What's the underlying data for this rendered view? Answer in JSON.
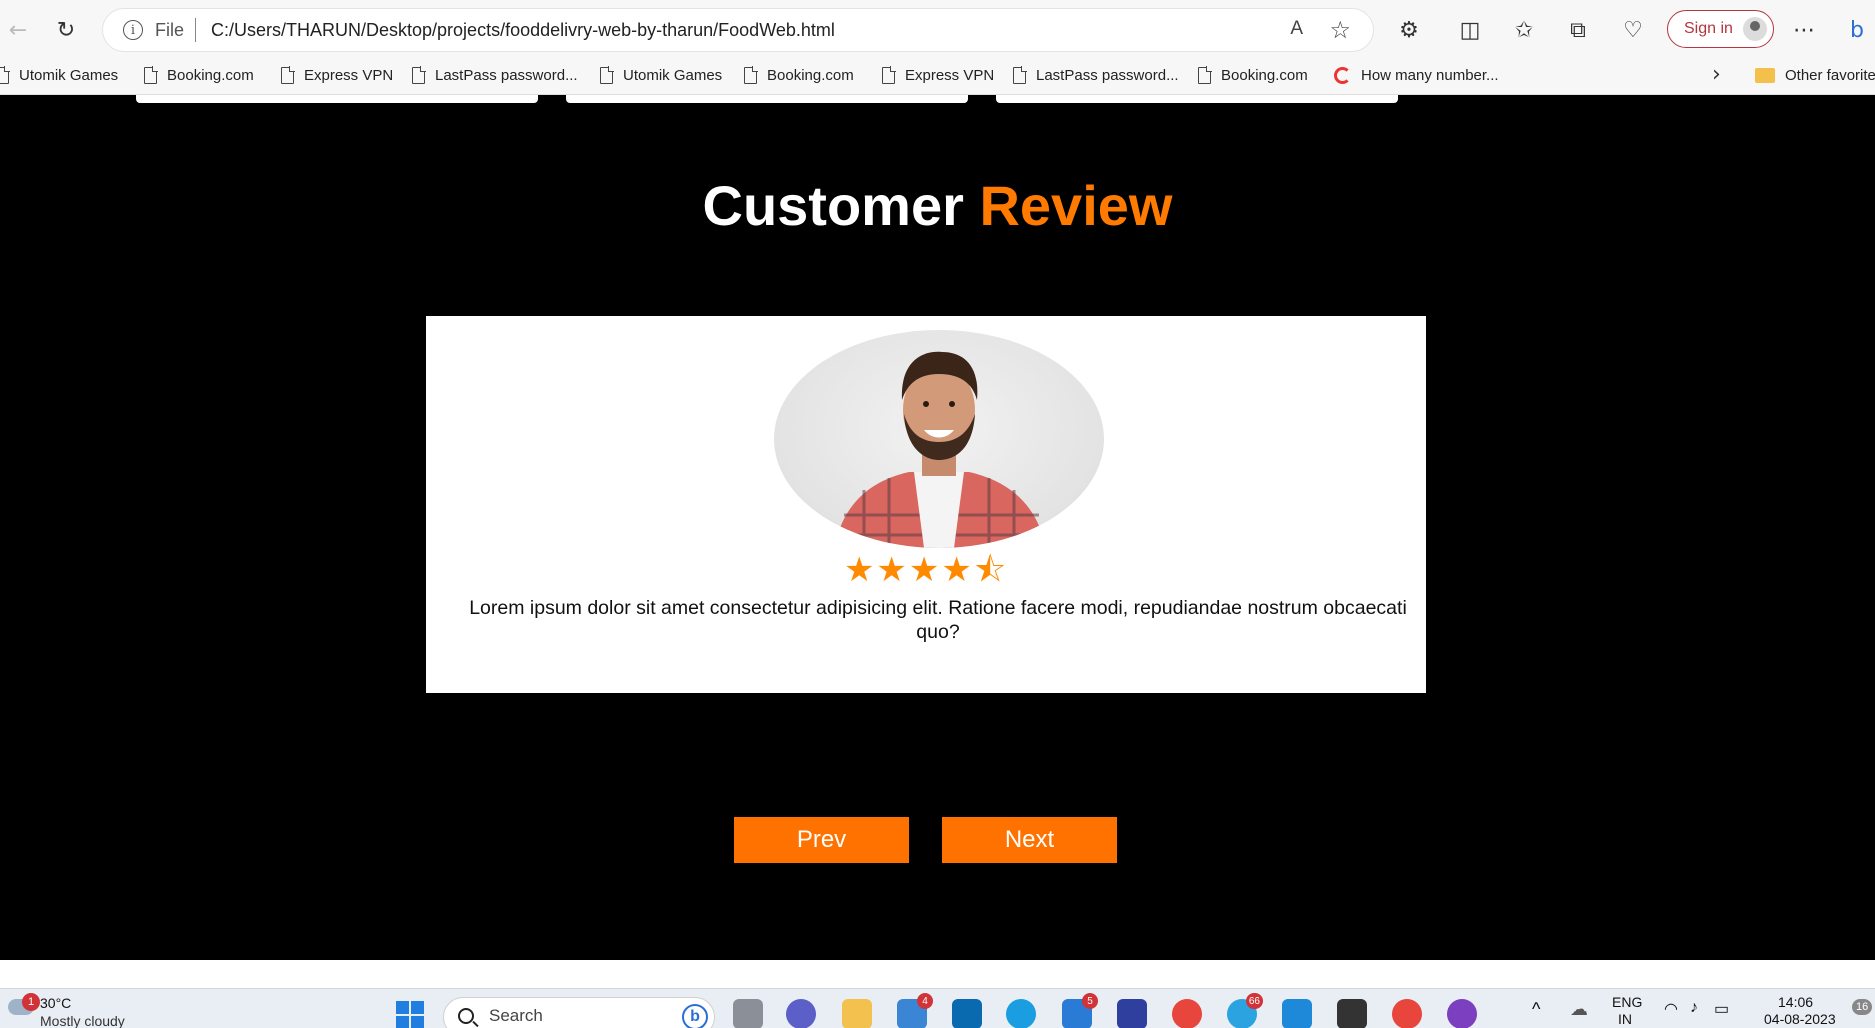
{
  "browser": {
    "address_prefix": "File",
    "url": "C:/Users/THARUN/Desktop/projects/fooddelivry-web-by-tharun/FoodWeb.html",
    "sign_in_label": "Sign in",
    "read_aloud_label": "A",
    "bookmarks": [
      {
        "label": "Utomik Games",
        "icon": "doc-icon"
      },
      {
        "label": "Booking.com",
        "icon": "doc-icon"
      },
      {
        "label": "Express VPN",
        "icon": "doc-icon"
      },
      {
        "label": "LastPass password...",
        "icon": "doc-icon"
      },
      {
        "label": "Utomik Games",
        "icon": "doc-icon"
      },
      {
        "label": "Booking.com",
        "icon": "doc-icon"
      },
      {
        "label": "Express VPN",
        "icon": "doc-icon"
      },
      {
        "label": "LastPass password...",
        "icon": "doc-icon"
      },
      {
        "label": "Booking.com",
        "icon": "doc-icon"
      },
      {
        "label": "How many number...",
        "icon": "google-icon"
      }
    ],
    "other_favorites_label": "Other favorite"
  },
  "page": {
    "title_part1": "Customer",
    "title_part2": "Review",
    "accent_color": "#ff7a00",
    "review": {
      "rating": 4.5,
      "stars_display": "★★★★⯪",
      "text": "Lorem ipsum dolor sit amet consectetur adipisicing elit. Ratione facere modi, repudiandae nostrum obcaecati quo?"
    },
    "prev_label": "Prev",
    "next_label": "Next"
  },
  "taskbar": {
    "weather_badge": "1",
    "temperature": "30°C",
    "condition": "Mostly cloudy",
    "search_placeholder": "Search",
    "mail_badge": "4",
    "app_badge_5": "5",
    "telegram_badge": "66",
    "language_line1": "ENG",
    "language_line2": "IN",
    "time": "14:06",
    "date": "04-08-2023",
    "notification_count": "16"
  }
}
